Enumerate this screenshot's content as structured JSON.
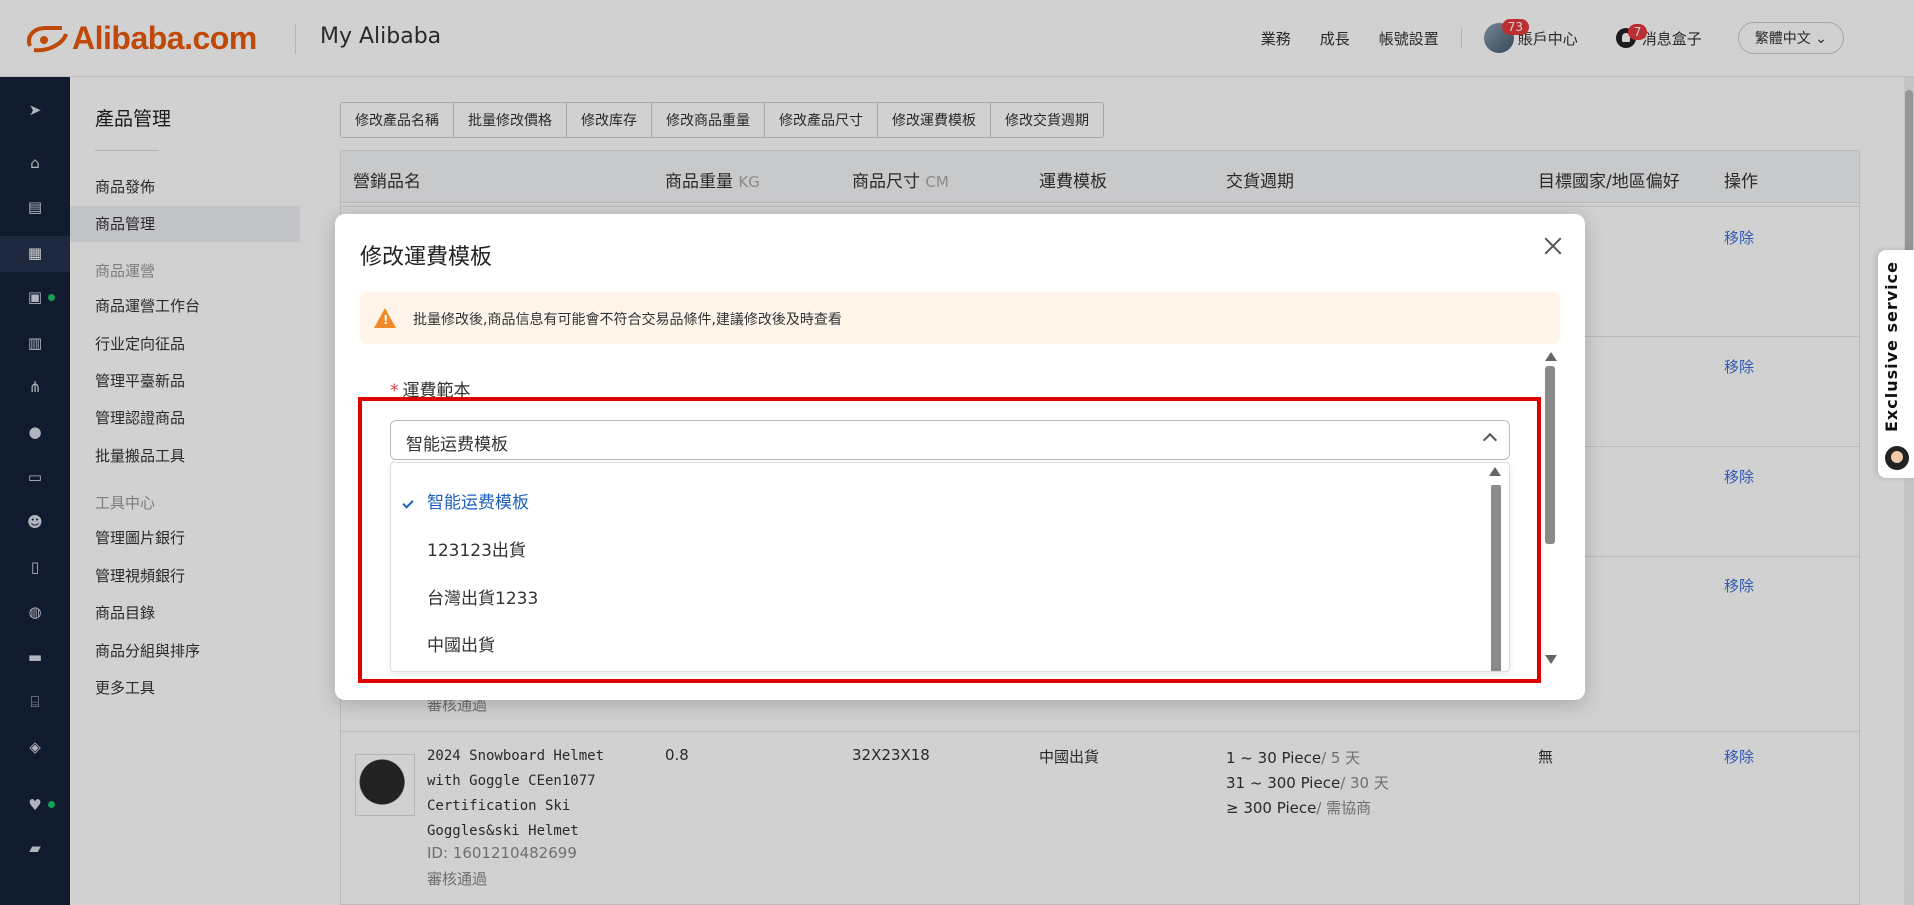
{
  "header": {
    "logo_text": "Alibaba.com",
    "section_title": "My Alibaba",
    "nav": [
      "業務",
      "成長",
      "帳號設置"
    ],
    "account": {
      "label": "賬戶中心",
      "badge": "73"
    },
    "messages": {
      "label": "消息盒子",
      "badge": "7"
    },
    "language": "繁體中文"
  },
  "sidebar": {
    "title": "產品管理",
    "items_top": [
      "商品發佈",
      "商品管理"
    ],
    "group1": "商品運營",
    "group1_items": [
      "商品運營工作台",
      "行业定向征品",
      "管理平臺新品",
      "管理認證商品",
      "批量搬品工具"
    ],
    "group2": "工具中心",
    "group2_items": [
      "管理圖片銀行",
      "管理視頻銀行",
      "商品目錄",
      "商品分組與排序",
      "更多工具"
    ]
  },
  "toolbar": {
    "buttons": [
      "修改產品名稱",
      "批量修改價格",
      "修改库存",
      "修改商品重量",
      "修改產品尺寸",
      "修改運費模板",
      "修改交貨週期"
    ]
  },
  "table": {
    "headers": {
      "name": "營銷品名",
      "weight": "商品重量",
      "weight_unit": "KG",
      "size": "商品尺寸",
      "size_unit": "CM",
      "shipping": "運費模板",
      "lead_time": "交貨週期",
      "target": "目標國家/地區偏好",
      "action": "操作"
    },
    "remove_label": "移除",
    "partial_status": "審核通過",
    "last_row": {
      "name_lines": [
        "2024 Snowboard Helmet",
        "with Goggle CEen1077",
        "Certification Ski",
        "Goggles&ski Helmet"
      ],
      "id": "ID: 1601210482699",
      "status": "審核通過",
      "weight": "0.8",
      "size": "32X23X18",
      "shipping": "中國出貨",
      "lead": [
        {
          "range": "1 ~ 30 Piece",
          "days": "/ 5 天"
        },
        {
          "range": "31 ~ 300 Piece",
          "days": "/ 30 天"
        },
        {
          "range": "≥ 300 Piece",
          "days": "/ 需協商"
        }
      ],
      "target": "無"
    }
  },
  "modal": {
    "title": "修改運費模板",
    "warning": "批量修改後,商品信息有可能會不符合交易品條件,建議修改後及時查看",
    "field_required_mark": "*",
    "field_label": "運費範本",
    "select_value": "智能运费模板",
    "options": [
      "智能运费模板",
      "123123出貨",
      "台灣出貨1233",
      "中國出貨"
    ],
    "selected_index": 0
  },
  "side_widget": {
    "label": "Exclusive service"
  },
  "colors": {
    "brand": "#e8590c",
    "rail": "#15213b",
    "highlight": "#e00000",
    "link": "#3b6fd8",
    "selected_option": "#1e5fbf"
  }
}
